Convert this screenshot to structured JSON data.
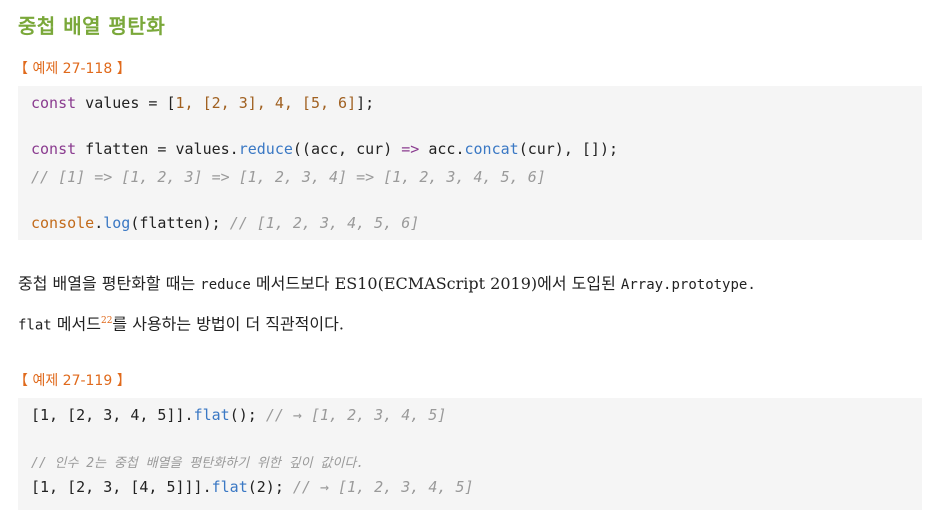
{
  "heading": "중첩 배열 평탄화",
  "example1": {
    "label": "【 예제 27-118 】",
    "lines": {
      "l1_kw": "const",
      "l1_rest": " values = [",
      "l1_vals": "1, [2, 3], 4, [5, 6]",
      "l1_end": "];",
      "l2_kw": "const",
      "l2_a": " flatten = values.",
      "l2_fn": "reduce",
      "l2_b": "((acc, cur) ",
      "l2_arrow": "=>",
      "l2_c": " acc.",
      "l2_fn2": "concat",
      "l2_d": "(cur), []);",
      "l3_cmt": "// [1] => [1, 2, 3] => [1, 2, 3, 4] => [1, 2, 3, 4, 5, 6]",
      "l4_a": "console",
      "l4_b": ".",
      "l4_fn": "log",
      "l4_c": "(flatten); ",
      "l4_cmt": "// [1, 2, 3, 4, 5, 6]"
    }
  },
  "paragraph": {
    "t1": "중첩 배열을 평탄화할 때는 ",
    "code1": "reduce",
    "t2": " 메서드보다 ES10(ECMAScript 2019)에서 도입된 ",
    "code2": "Array.prototype.",
    "code3": "flat",
    "t3": " 메서드",
    "footnote": "22",
    "t4": "를 사용하는 방법이 더 직관적이다."
  },
  "example2": {
    "label": "【 예제 27-119 】",
    "lines": {
      "l1_a": "[1, [2, 3, 4, 5]].",
      "l1_fn": "flat",
      "l1_b": "(); ",
      "l1_cmt": "// → [1, 2, 3, 4, 5]",
      "l2_cmt": "// 인수 2는 중첩 배열을 평탄화하기 위한 깊이 값이다.",
      "l3_a": "[1, [2, 3, [4, 5]]].",
      "l3_fn": "flat",
      "l3_b": "(2); ",
      "l3_cmt": "// → [1, 2, 3, 4, 5]"
    }
  }
}
